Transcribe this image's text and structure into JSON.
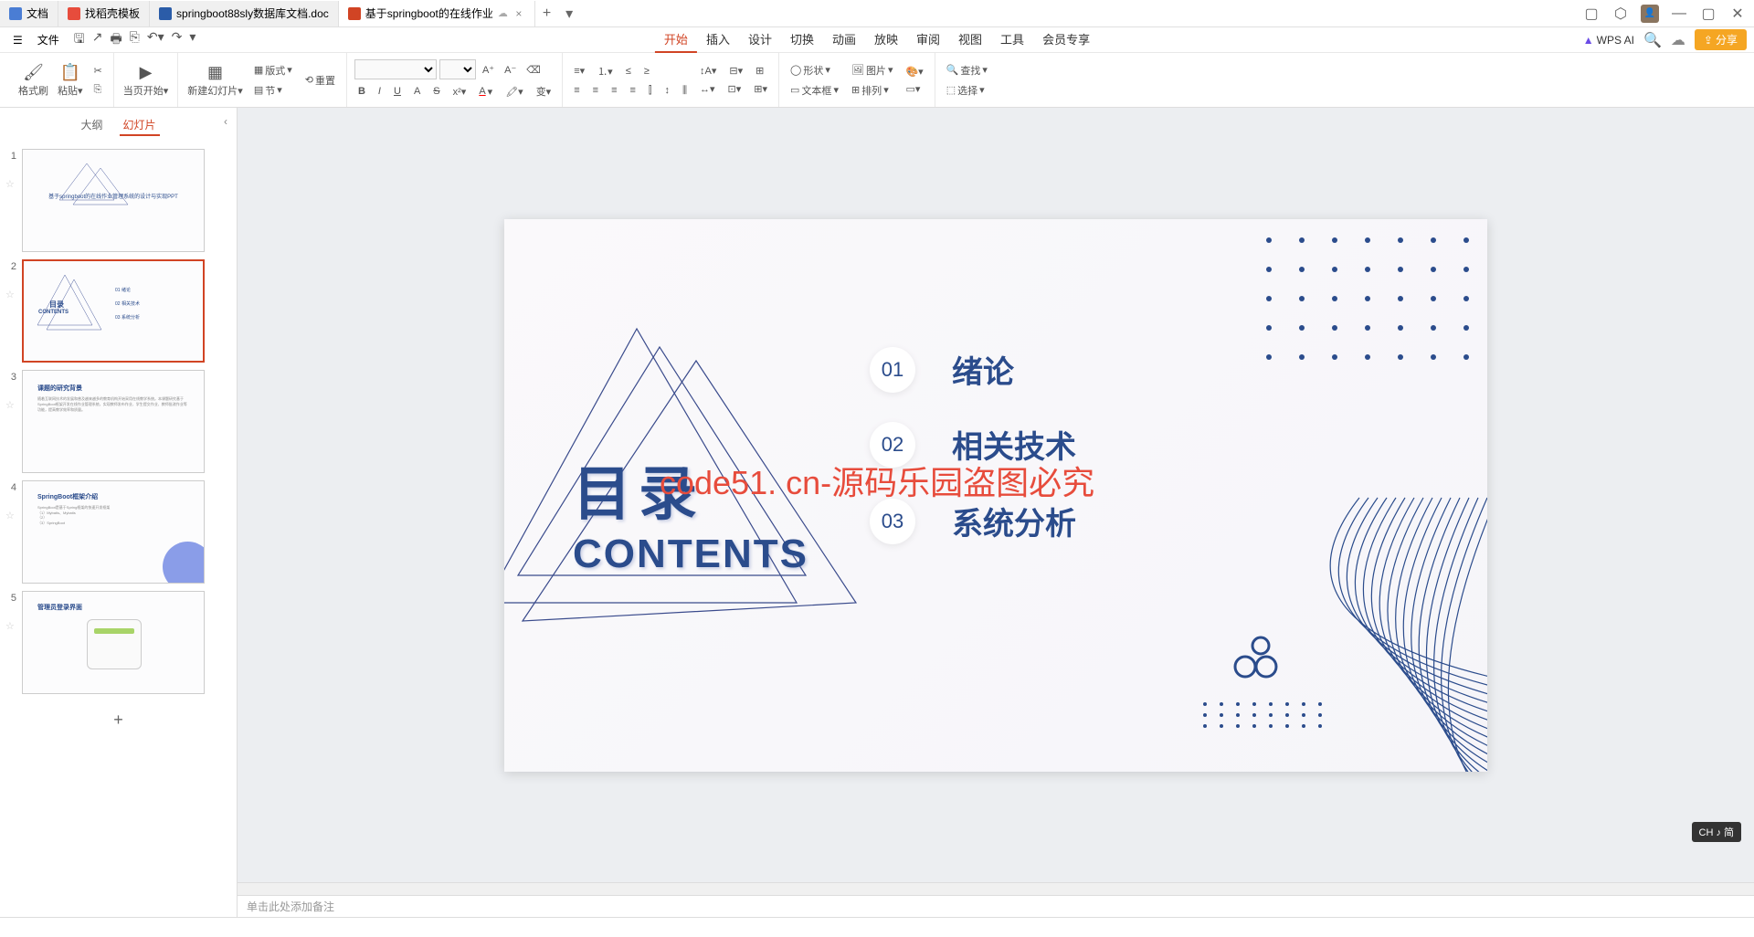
{
  "tabs": [
    {
      "label": "文档",
      "icon": "#4a7dd4"
    },
    {
      "label": "找稻壳模板",
      "icon": "#e74c3c"
    },
    {
      "label": "springboot88sly数据库文档.doc",
      "icon": "#2b5ca8"
    },
    {
      "label": "基于springboot的在线作业",
      "icon": "#d14424",
      "active": true
    }
  ],
  "menu": {
    "file": "文件",
    "tabs": [
      "开始",
      "插入",
      "设计",
      "切换",
      "动画",
      "放映",
      "审阅",
      "视图",
      "工具",
      "会员专享"
    ],
    "active": "开始",
    "wps_ai": "WPS AI",
    "share": "分享"
  },
  "ribbon": {
    "format_painter": "格式刷",
    "paste": "粘贴",
    "start_from": "当页开始",
    "new_slide": "新建幻灯片",
    "layout": "版式",
    "section": "节",
    "reset": "重置",
    "shape": "形状",
    "image": "图片",
    "textbox": "文本框",
    "arrange": "排列",
    "find": "查找",
    "select": "选择"
  },
  "side": {
    "outline": "大纲",
    "slides": "幻灯片"
  },
  "thumbs": {
    "t1_title": "基于springboot的在线作业管理系统的设计与实现PPT",
    "t2_title": "目录",
    "t2_en": "CONTENTS",
    "t2_i1": "绪论",
    "t2_i2": "相关技术",
    "t2_i3": "系统分析",
    "t3_title": "课题的研究背景",
    "t4_title": "SpringBoot框架介绍",
    "t5_title": "管理员登录界面"
  },
  "slide": {
    "title_cn": "目录",
    "title_en": "CONTENTS",
    "items": [
      {
        "num": "01",
        "text": "绪论"
      },
      {
        "num": "02",
        "text": "相关技术"
      },
      {
        "num": "03",
        "text": "系统分析"
      }
    ],
    "watermark": "code51. cn-源码乐园盗图必究"
  },
  "notes_placeholder": "单击此处添加备注",
  "ime": "CH ♪ 简"
}
